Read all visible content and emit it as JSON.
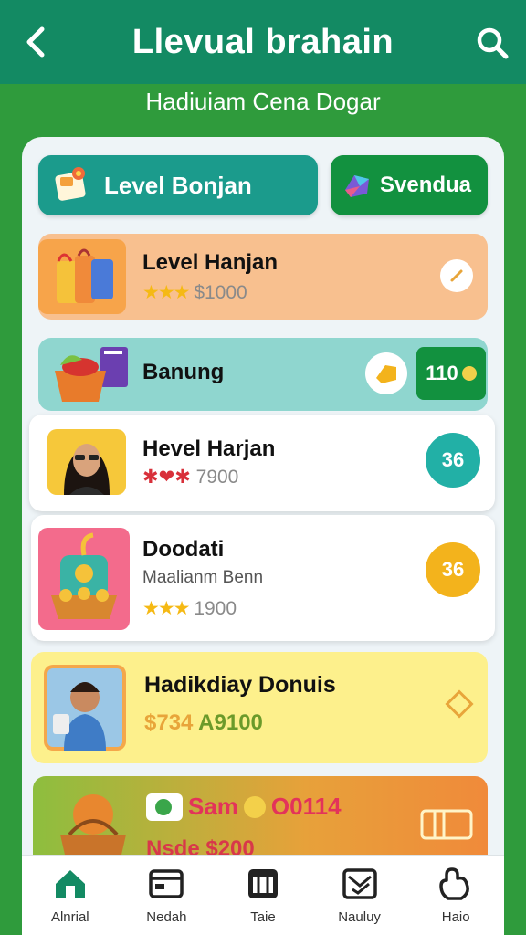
{
  "header": {
    "title": "Llevual brahain",
    "subtitle": "Hadiuiam Cena Dogar"
  },
  "tabs": [
    {
      "label": "Level Bonjan"
    },
    {
      "label": "Svendua"
    }
  ],
  "cards": [
    {
      "title": "Level Hanjan",
      "meta": "$1000",
      "stars": "★★★"
    },
    {
      "title": "Banung",
      "badge": "110"
    },
    {
      "title": "Hevel Harjan",
      "meta": "7900",
      "badge": "36",
      "marks": "✱❤✱"
    },
    {
      "title": "Doodati",
      "subtitle": "Maalianm Benn",
      "meta": "1900",
      "stars": "★★★",
      "badge": "36"
    },
    {
      "title": "Hadikdiay Donuis",
      "price1": "$734",
      "price2": "A9100"
    },
    {
      "title": "Sam",
      "tag": "O0114",
      "meta": "Nsde $200"
    }
  ],
  "nav": [
    {
      "label": "Alnrial"
    },
    {
      "label": "Nedah"
    },
    {
      "label": "Taie"
    },
    {
      "label": "Nauluy"
    },
    {
      "label": "Haio"
    }
  ],
  "colors": {
    "header": "#138a63",
    "background": "#2f9b3c",
    "accent_teal": "#1b9b8c",
    "accent_yellow": "#f3b31c"
  }
}
